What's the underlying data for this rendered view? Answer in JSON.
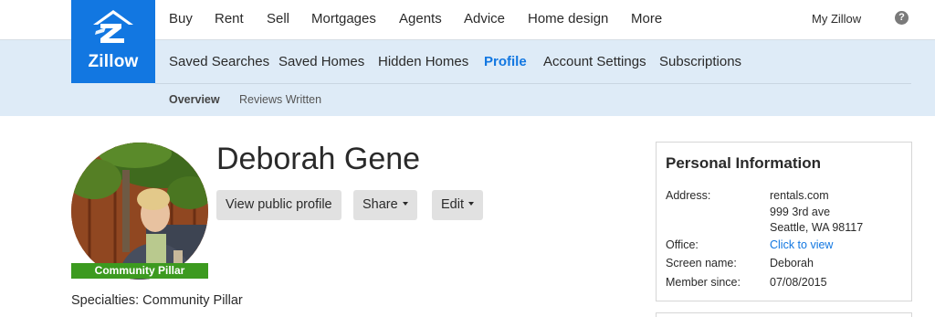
{
  "brand": {
    "name": "Zillow",
    "color": "#1277e1",
    "icon": "zillow-z-logo"
  },
  "top_nav": {
    "items": [
      "Buy",
      "Rent",
      "Sell",
      "Mortgages",
      "Agents",
      "Advice",
      "Home design",
      "More"
    ],
    "my_zillow": "My Zillow",
    "help_symbol": "?"
  },
  "sub_nav": {
    "items": [
      "Saved Searches",
      "Saved Homes",
      "Hidden Homes",
      "Profile",
      "Account Settings",
      "Subscriptions"
    ],
    "active": "Profile"
  },
  "tertiary_nav": {
    "items": [
      "Overview",
      "Reviews Written"
    ],
    "active": "Overview"
  },
  "profile": {
    "name": "Deborah Gene",
    "badge": "Community Pillar",
    "badge_color": "#3c9a1f",
    "buttons": {
      "view_public": "View public profile",
      "share": "Share",
      "edit": "Edit"
    },
    "specialties": "Specialties: Community Pillar"
  },
  "personal_info": {
    "title": "Personal Information",
    "address_label": "Address:",
    "address_lines": [
      "rentals.com",
      "999 3rd ave",
      "Seattle, WA  98117"
    ],
    "office_label": "Office:",
    "office_value": "Click to view",
    "screen_name_label": "Screen name:",
    "screen_name": "Deborah",
    "member_since_label": "Member since:",
    "member_since": "07/08/2015"
  }
}
